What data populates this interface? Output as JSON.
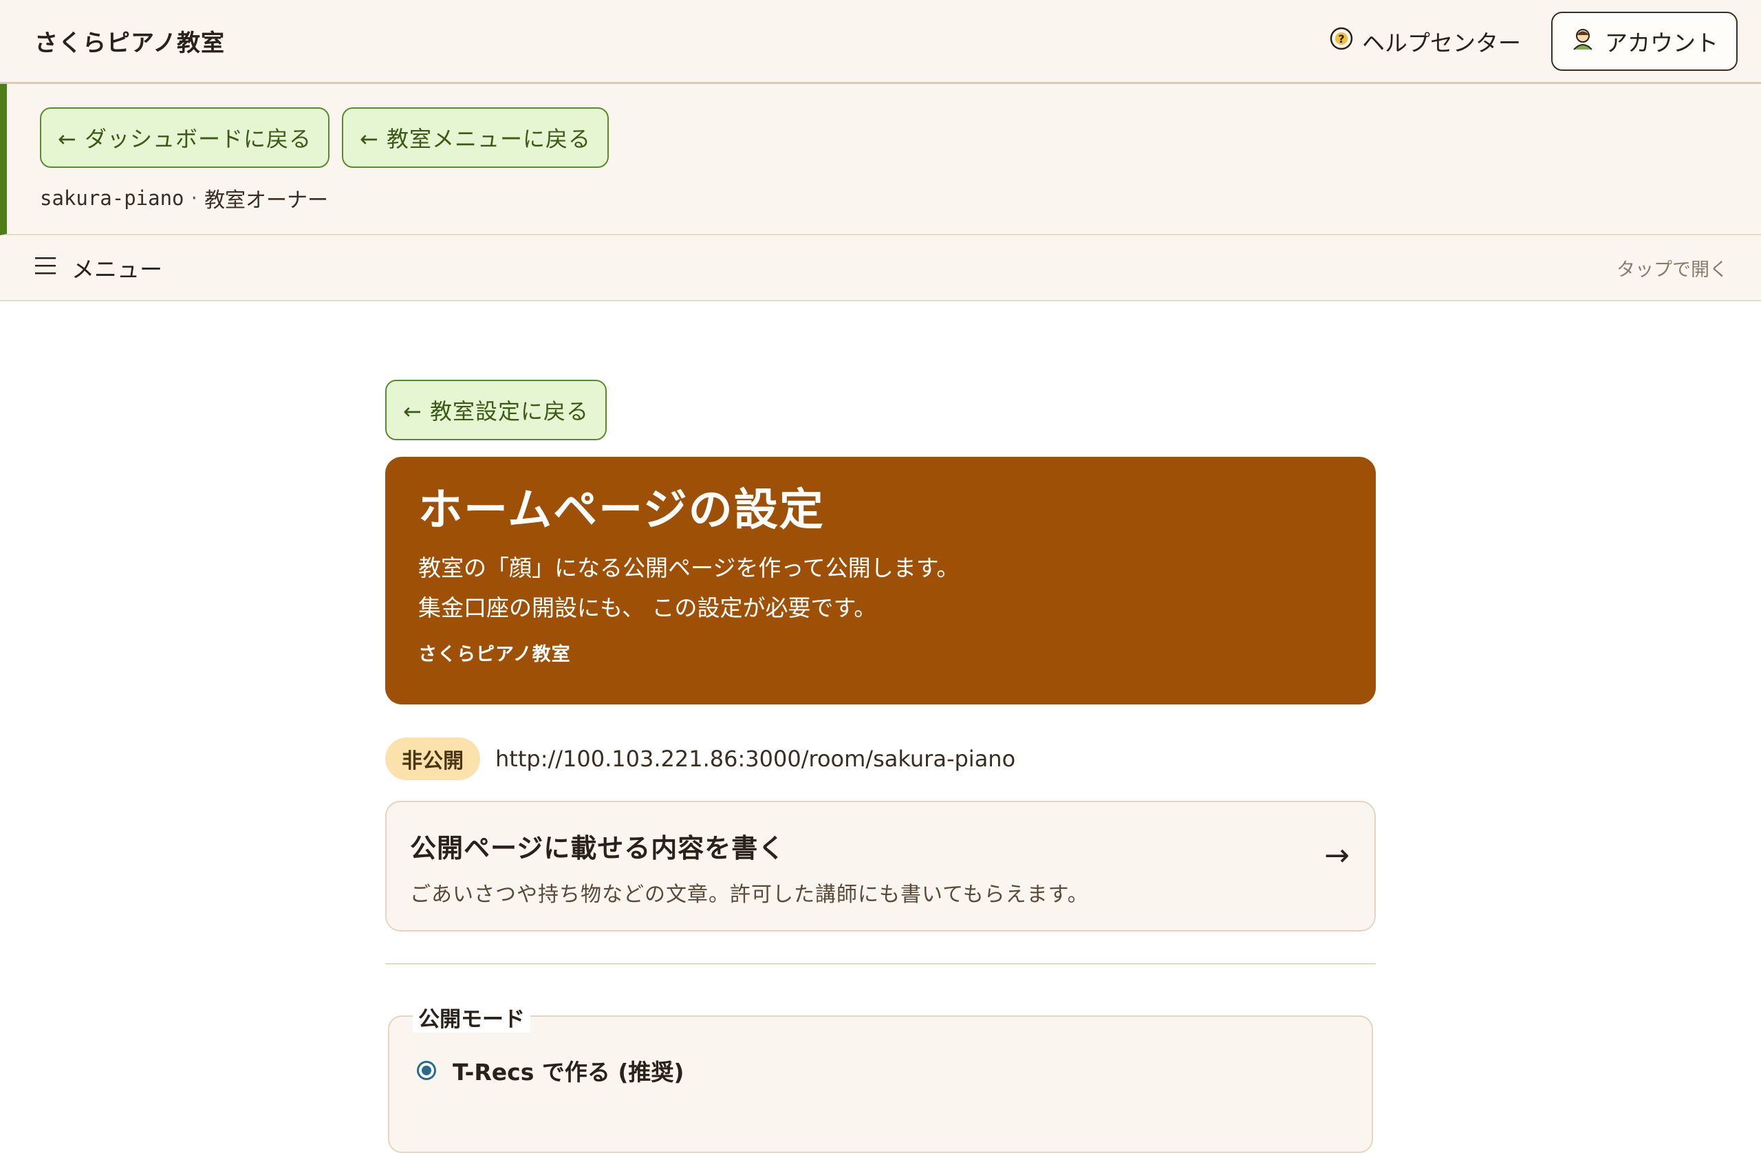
{
  "header": {
    "brand": "さくらピアノ教室",
    "help_label": "ヘルプセンター",
    "account_label": "アカウント"
  },
  "context": {
    "back_dashboard": "← ダッシュボードに戻る",
    "back_room_menu": "← 教室メニューに戻る",
    "slug": "sakura-piano",
    "separator": "·",
    "role": "教室オーナー"
  },
  "menubar": {
    "label": "メニュー",
    "hint": "タップで開く"
  },
  "main": {
    "back_settings": "← 教室設定に戻る",
    "hero": {
      "title": "ホームページの設定",
      "desc_line1": "教室の「顔」になる公開ページを作って公開します。",
      "desc_line2": "集金口座の開設にも、 この設定が必要です。",
      "room_name": "さくらピアノ教室"
    },
    "status": {
      "badge": "非公開",
      "url": "http://100.103.221.86:3000/room/sakura-piano"
    },
    "content_card": {
      "title": "公開ページに載せる内容を書く",
      "desc": "ごあいさつや持ち物などの文章。許可した講師にも書いてもらえます。",
      "arrow": "→"
    },
    "publish_mode": {
      "legend": "公開モード",
      "options": [
        {
          "label": "T-Recs で作る (推奨)",
          "selected": true
        }
      ]
    }
  },
  "colors": {
    "hero_bg": "#9e5006",
    "accent_green": "#4e7d1c",
    "badge_bg": "#fbe2ad",
    "radio": "#2a6a8a"
  }
}
